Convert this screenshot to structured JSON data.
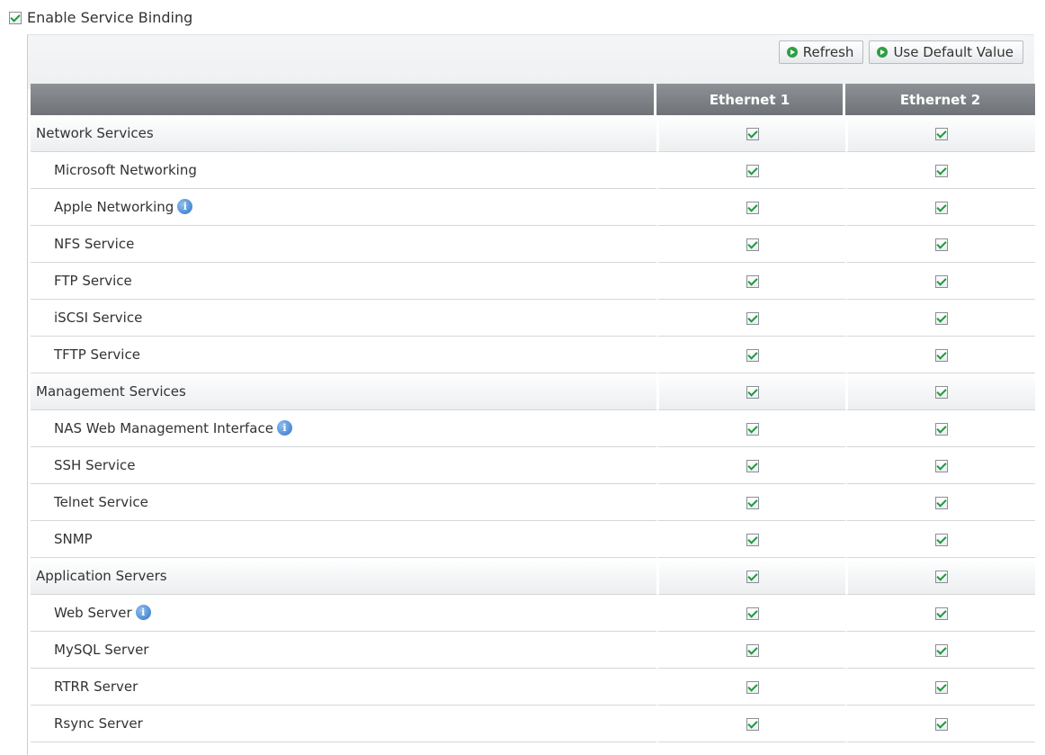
{
  "enable": {
    "label": "Enable Service Binding",
    "checked": true
  },
  "toolbar": {
    "refresh_label": "Refresh",
    "default_label": "Use Default Value"
  },
  "table": {
    "headers": [
      "",
      "Ethernet 1",
      "Ethernet 2"
    ],
    "rows": [
      {
        "label": "Network Services",
        "group": true,
        "info": false,
        "eth1": true,
        "eth2": true
      },
      {
        "label": "Microsoft Networking",
        "group": false,
        "info": false,
        "eth1": true,
        "eth2": true
      },
      {
        "label": "Apple Networking",
        "group": false,
        "info": true,
        "eth1": true,
        "eth2": true
      },
      {
        "label": "NFS Service",
        "group": false,
        "info": false,
        "eth1": true,
        "eth2": true
      },
      {
        "label": "FTP Service",
        "group": false,
        "info": false,
        "eth1": true,
        "eth2": true
      },
      {
        "label": "iSCSI Service",
        "group": false,
        "info": false,
        "eth1": true,
        "eth2": true
      },
      {
        "label": "TFTP Service",
        "group": false,
        "info": false,
        "eth1": true,
        "eth2": true
      },
      {
        "label": "Management Services",
        "group": true,
        "info": false,
        "eth1": true,
        "eth2": true
      },
      {
        "label": "NAS Web Management Interface",
        "group": false,
        "info": true,
        "eth1": true,
        "eth2": true
      },
      {
        "label": "SSH Service",
        "group": false,
        "info": false,
        "eth1": true,
        "eth2": true
      },
      {
        "label": "Telnet Service",
        "group": false,
        "info": false,
        "eth1": true,
        "eth2": true
      },
      {
        "label": "SNMP",
        "group": false,
        "info": false,
        "eth1": true,
        "eth2": true
      },
      {
        "label": "Application Servers",
        "group": true,
        "info": false,
        "eth1": true,
        "eth2": true
      },
      {
        "label": "Web Server",
        "group": false,
        "info": true,
        "eth1": true,
        "eth2": true
      },
      {
        "label": "MySQL Server",
        "group": false,
        "info": false,
        "eth1": true,
        "eth2": true
      },
      {
        "label": "RTRR Server",
        "group": false,
        "info": false,
        "eth1": true,
        "eth2": true
      },
      {
        "label": "Rsync Server",
        "group": false,
        "info": false,
        "eth1": true,
        "eth2": true
      }
    ]
  },
  "icons": {
    "info": "info-icon",
    "go": "arrow-right-circle-icon",
    "check": "checkbox-checked-icon"
  },
  "colors": {
    "header_bg": "#7a7e82",
    "check": "#1f9a3a",
    "info": "#2f73c9",
    "go": "#2ea043"
  }
}
